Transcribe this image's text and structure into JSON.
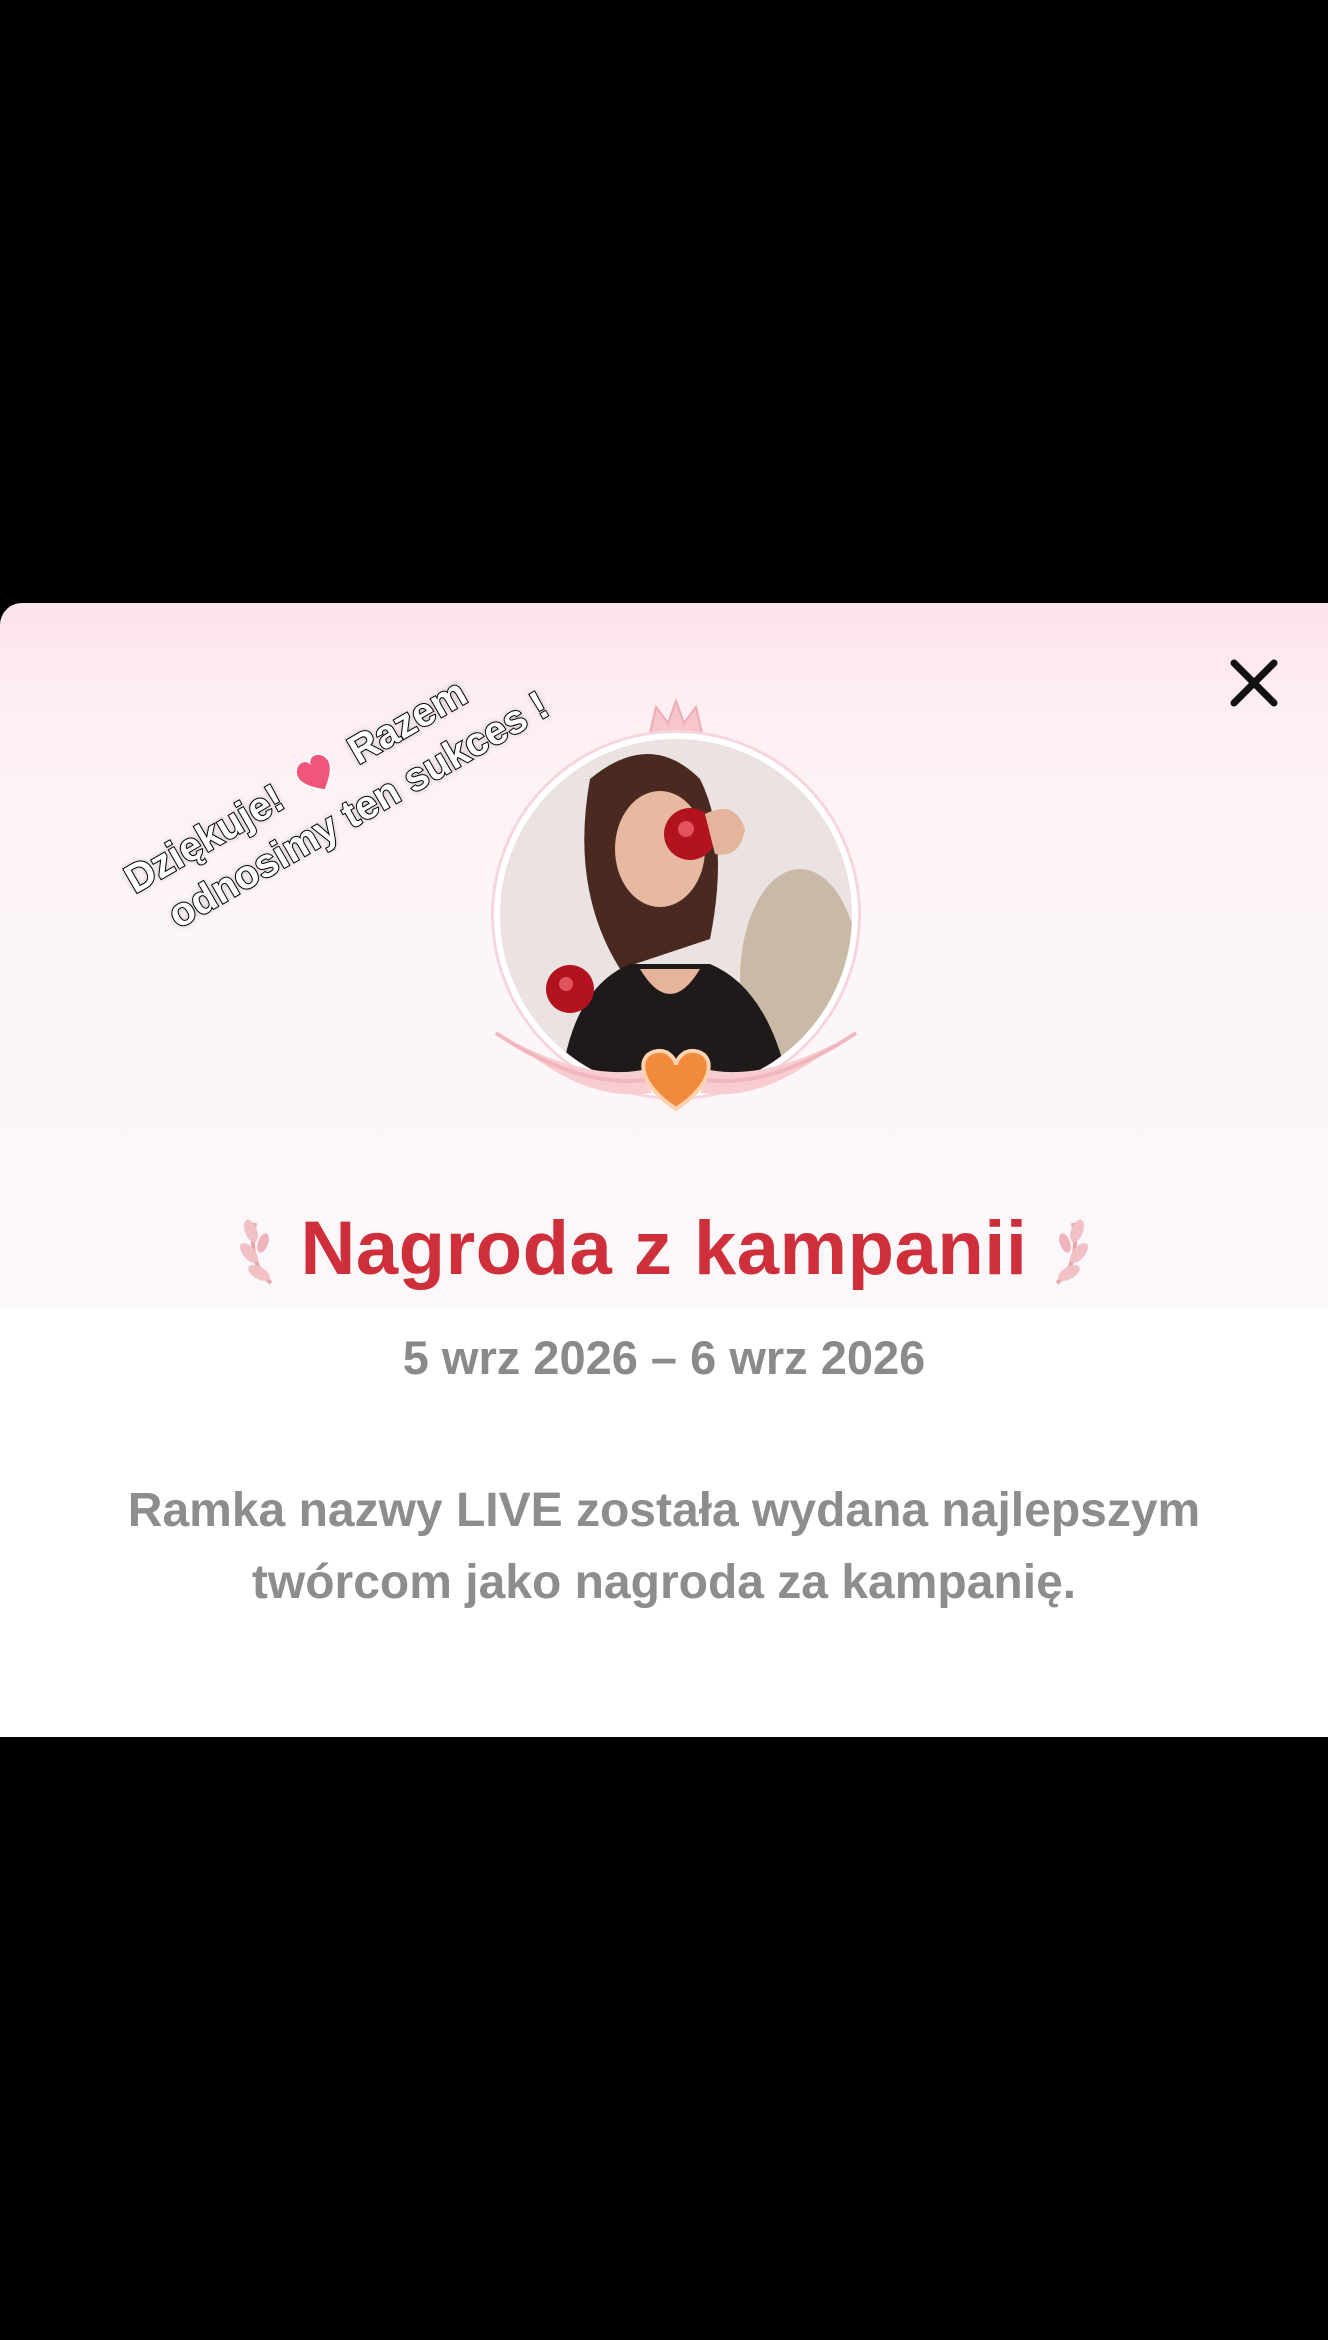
{
  "dialog": {
    "title": "Nagroda z kampanii",
    "dates": "5 wrz 2026 – 6 wrz 2026",
    "description": "Ramka nazwy LIVE została wydana najlepszym twórcom jako nagroda za kampanię.",
    "close_icon": "close-icon"
  },
  "overlay": {
    "line1_a": "Dziękuje!",
    "line1_b": "Razem",
    "line2": "odnosimy ten sukces !",
    "emoji": "heart-emoji"
  },
  "colors": {
    "title": "#cf2f3a",
    "text_gray": "#8d8d8d",
    "card_top": "#fde3ea",
    "heart_orange": "#f28a3c",
    "laurel": "#e8a7ad"
  }
}
